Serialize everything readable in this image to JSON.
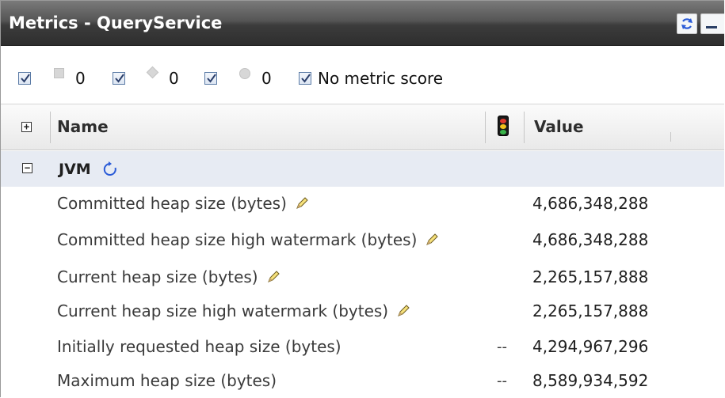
{
  "window": {
    "title": "Metrics - QueryService"
  },
  "filters": [
    {
      "checked": true,
      "shape": "square",
      "count": "0"
    },
    {
      "checked": true,
      "shape": "diamond",
      "count": "0"
    },
    {
      "checked": true,
      "shape": "circle",
      "count": "0"
    },
    {
      "checked": true,
      "label": "No metric score"
    }
  ],
  "table": {
    "columns": {
      "name": "Name",
      "value": "Value"
    },
    "group": {
      "label": "JVM"
    },
    "rows": [
      {
        "name": "Committed heap size (bytes)",
        "status": "",
        "value": "4,686,348,288",
        "editable": true
      },
      {
        "name": "Committed heap size high watermark (bytes)",
        "status": "",
        "value": "4,686,348,288",
        "editable": true
      },
      {
        "name": "Current heap size (bytes)",
        "status": "",
        "value": "2,265,157,888",
        "editable": true
      },
      {
        "name": "Current heap size high watermark (bytes)",
        "status": "",
        "value": "2,265,157,888",
        "editable": true
      },
      {
        "name": "Initially requested heap size (bytes)",
        "status": "--",
        "value": "4,294,967,296",
        "editable": false
      },
      {
        "name": "Maximum heap size (bytes)",
        "status": "--",
        "value": "8,589,934,592",
        "editable": false
      }
    ]
  },
  "colors": {
    "titlebar": "#3c3c3c",
    "group_row": "#e7ebf3",
    "checkbox_border": "#5a7aa5",
    "refresh_icon": "#2a5bd7"
  }
}
